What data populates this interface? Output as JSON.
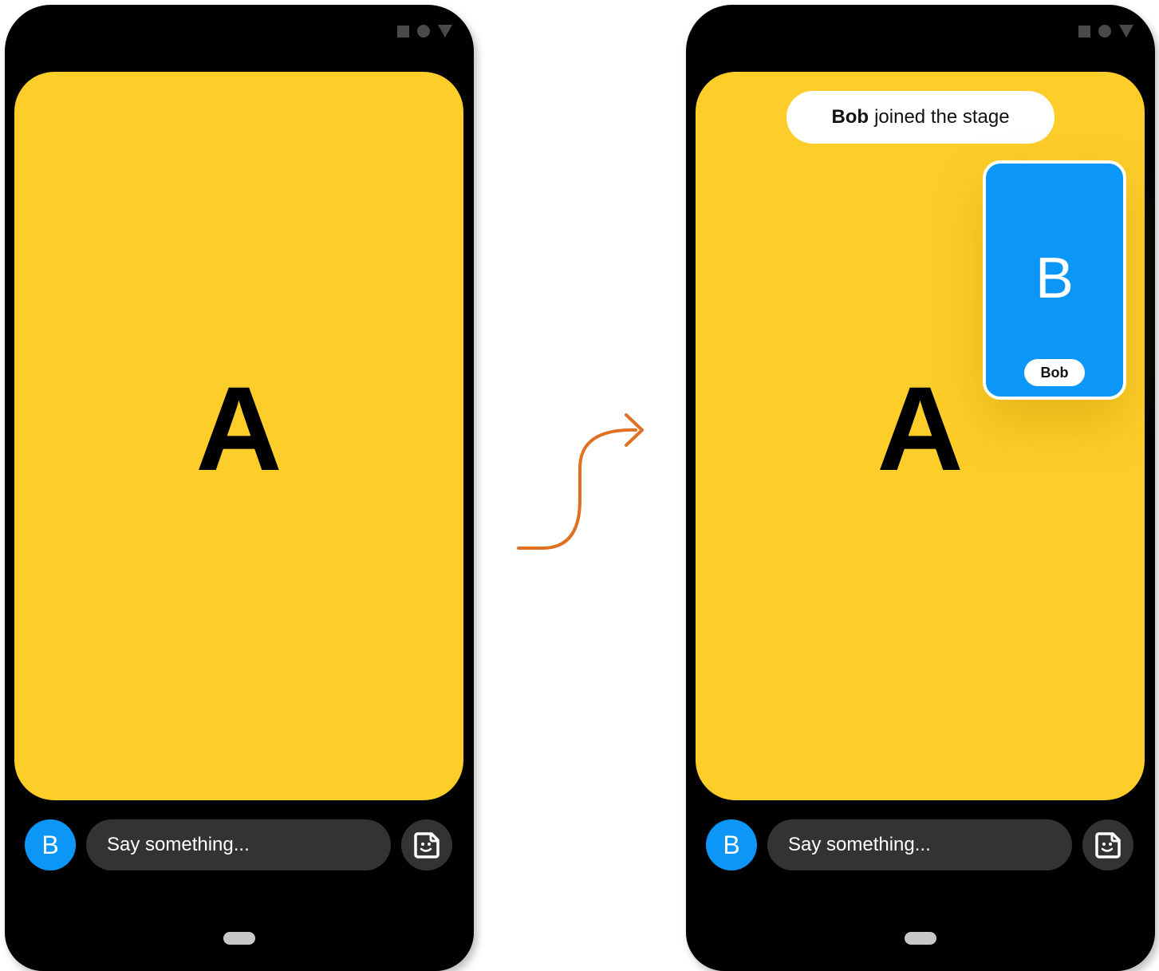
{
  "colors": {
    "video_background": "#fdcd29",
    "participant_blue": "#0b96f8",
    "input_background": "#333333",
    "arrow": "#e07022"
  },
  "status_bar": {
    "icons": [
      "square-icon",
      "circle-icon",
      "triangle-icon"
    ]
  },
  "before": {
    "main_participant_letter": "A",
    "avatar_letter": "B",
    "message_placeholder": "Say something...",
    "sticker_icon": "sticker-face-icon"
  },
  "transition": {
    "icon": "curved-arrow-right-icon"
  },
  "after": {
    "toast": {
      "name": "Bob",
      "message": "joined the stage"
    },
    "main_participant_letter": "A",
    "pip": {
      "letter": "B",
      "name": "Bob"
    },
    "avatar_letter": "B",
    "message_placeholder": "Say something...",
    "sticker_icon": "sticker-face-icon"
  }
}
